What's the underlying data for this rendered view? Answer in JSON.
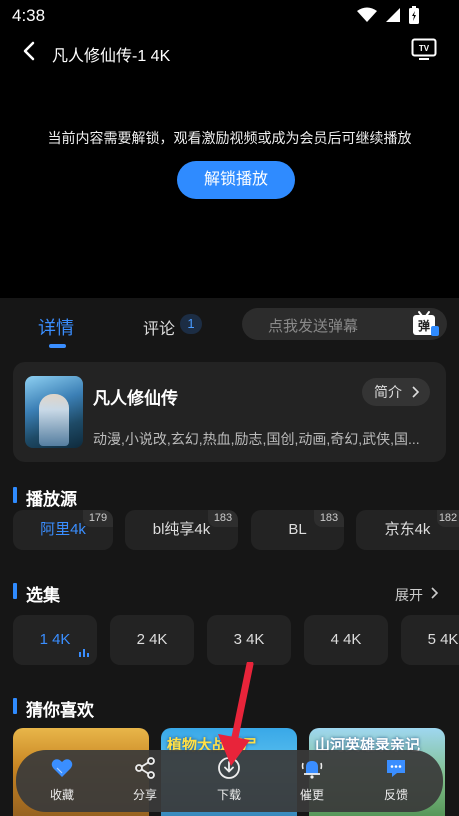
{
  "status_bar": {
    "time": "4:38"
  },
  "player": {
    "title": "凡人修仙传-1 4K",
    "lock_message": "当前内容需要解锁，观看激励视频或成为会员后可继续播放",
    "unlock_label": "解锁播放"
  },
  "tabs": {
    "detail": "详情",
    "comment": "评论",
    "comment_count": "1",
    "danmu_placeholder": "点我发送弹幕",
    "danmu_icon_char": "弹"
  },
  "show": {
    "title": "凡人修仙传",
    "intro_label": "简介",
    "tags": "动漫,小说改,玄幻,热血,励志,国创,动画,奇幻,武侠,国..."
  },
  "sources": {
    "title": "播放源",
    "items": [
      {
        "label": "阿里4k",
        "count": "179",
        "active": true
      },
      {
        "label": "bl纯享4k",
        "count": "183",
        "active": false
      },
      {
        "label": "BL",
        "count": "183",
        "active": false
      },
      {
        "label": "京东4k",
        "count": "182",
        "active": false
      }
    ]
  },
  "episodes": {
    "title": "选集",
    "expand_label": "展开",
    "items": [
      {
        "label": "1 4K",
        "active": true
      },
      {
        "label": "2 4K",
        "active": false
      },
      {
        "label": "3 4K",
        "active": false
      },
      {
        "label": "4 4K",
        "active": false
      },
      {
        "label": "5 4K",
        "active": false
      }
    ]
  },
  "recommendations": {
    "title": "猜你喜欢",
    "items": [
      {
        "text": ""
      },
      {
        "text": "植物大战僵尸"
      },
      {
        "text": "山河英雄录亲记"
      }
    ]
  },
  "actions": [
    {
      "label": "收藏",
      "icon": "heart-icon"
    },
    {
      "label": "分享",
      "icon": "share-icon"
    },
    {
      "label": "下载",
      "icon": "download-icon"
    },
    {
      "label": "催更",
      "icon": "bell-icon"
    },
    {
      "label": "反馈",
      "icon": "feedback-icon"
    }
  ],
  "colors": {
    "accent": "#2f8bff",
    "panel_bg": "#161616",
    "card_bg": "#232323",
    "annotation": "#e8243a"
  }
}
